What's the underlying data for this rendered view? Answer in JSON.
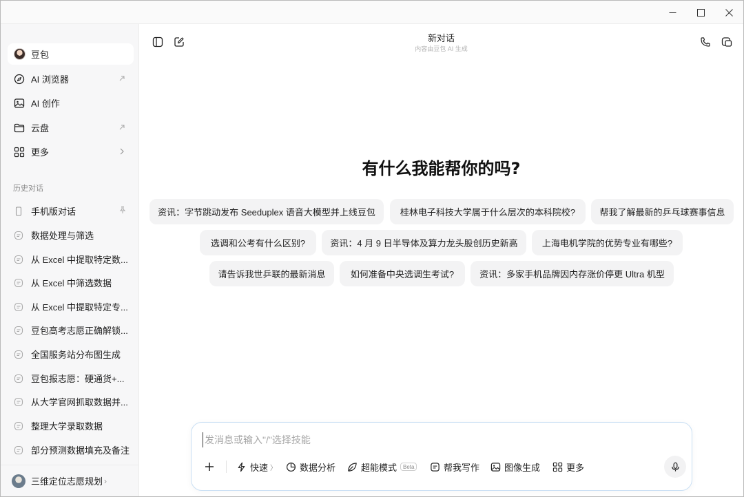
{
  "sidebar": {
    "nav": [
      {
        "label": "豆包",
        "icon": "doubao-avatar-icon"
      },
      {
        "label": "AI 浏览器",
        "icon": "compass-icon",
        "trail": "external-arrow-icon"
      },
      {
        "label": "AI 创作",
        "icon": "image-icon"
      },
      {
        "label": "云盘",
        "icon": "folder-icon",
        "trail": "external-arrow-icon"
      },
      {
        "label": "更多",
        "icon": "grid-icon",
        "trail": "chevron-right-icon"
      }
    ],
    "history_title": "历史对话",
    "history": [
      {
        "label": "手机版对话",
        "icon": "phone-icon",
        "pinned": true
      },
      {
        "label": "数据处理与筛选",
        "icon": "chat-icon"
      },
      {
        "label": "从 Excel 中提取特定数...",
        "icon": "chat-icon"
      },
      {
        "label": "从 Excel 中筛选数据",
        "icon": "chat-icon"
      },
      {
        "label": "从 Excel 中提取特定专...",
        "icon": "chat-icon"
      },
      {
        "label": "豆包高考志愿正确解锁...",
        "icon": "chat-icon"
      },
      {
        "label": "全国服务站分布图生成",
        "icon": "chat-icon"
      },
      {
        "label": "豆包报志愿：硬通货+...",
        "icon": "chat-icon"
      },
      {
        "label": "从大学官网抓取数据并...",
        "icon": "chat-icon"
      },
      {
        "label": "整理大学录取数据",
        "icon": "chat-icon"
      },
      {
        "label": "部分预测数据填充及备注",
        "icon": "chat-icon"
      }
    ],
    "profile": {
      "name": "三维定位志愿规划",
      "chevron": "›"
    }
  },
  "main": {
    "title": "新对话",
    "subtitle": "内容由豆包 AI 生成",
    "headline": "有什么我能帮你的吗?",
    "suggestions": [
      "资讯：字节跳动发布 Seeduplex 语音大模型并上线豆包",
      "桂林电子科技大学属于什么层次的本科院校?",
      "帮我了解最新的乒乓球赛事信息",
      "选调和公考有什么区别?",
      "资讯：4 月 9 日半导体及算力龙头股创历史新高",
      "上海电机学院的优势专业有哪些?",
      "请告诉我世乒联的最新消息",
      "如何准备中央选调生考试?",
      "资讯：多家手机品牌因内存涨价停更 Ultra 机型"
    ]
  },
  "composer": {
    "placeholder": "发消息或输入\"/\"选择技能",
    "tools": [
      {
        "label": "快速",
        "icon": "lightning-icon"
      },
      {
        "label": "数据分析",
        "icon": "pie-chart-icon"
      },
      {
        "label": "超能模式",
        "icon": "leaf-icon",
        "badge": "Beta"
      },
      {
        "label": "帮我写作",
        "icon": "doc-icon"
      },
      {
        "label": "图像生成",
        "icon": "image-icon"
      },
      {
        "label": "更多",
        "icon": "grid-icon"
      }
    ]
  },
  "colors": {
    "accent_border": "#c9dff4",
    "chip_bg": "#f3f3f4",
    "sidebar_bg": "#f7f7f8"
  }
}
